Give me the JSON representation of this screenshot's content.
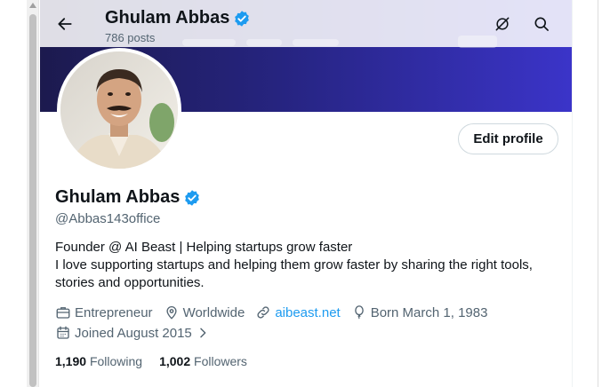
{
  "header": {
    "name": "Ghulam Abbas",
    "posts": "786 posts"
  },
  "profile": {
    "name": "Ghulam Abbas",
    "handle": "@Abbas143office",
    "edit_button": "Edit profile",
    "bio": [
      "Founder @ AI Beast | Helping startups grow faster",
      "I love supporting startups and helping them grow faster by sharing the right tools,",
      "stories and opportunities."
    ],
    "profession": "Entrepreneur",
    "location": "Worldwide",
    "website": "aibeast.net",
    "birthday": "Born March 1, 1983",
    "joined": "Joined August 2015",
    "following_count": "1,190",
    "following_label": "Following",
    "followers_count": "1,002",
    "followers_label": "Followers"
  },
  "colors": {
    "accent": "#1d9bf0",
    "verified": "#1d9bf0",
    "text": "#0f1419",
    "secondary": "#536471",
    "banner": "#2b27a0"
  },
  "icons": [
    "back-arrow-icon",
    "grok-icon",
    "search-icon",
    "verified-badge-icon",
    "briefcase-icon",
    "location-pin-icon",
    "link-icon",
    "balloon-icon",
    "calendar-icon",
    "chevron-right-icon"
  ]
}
